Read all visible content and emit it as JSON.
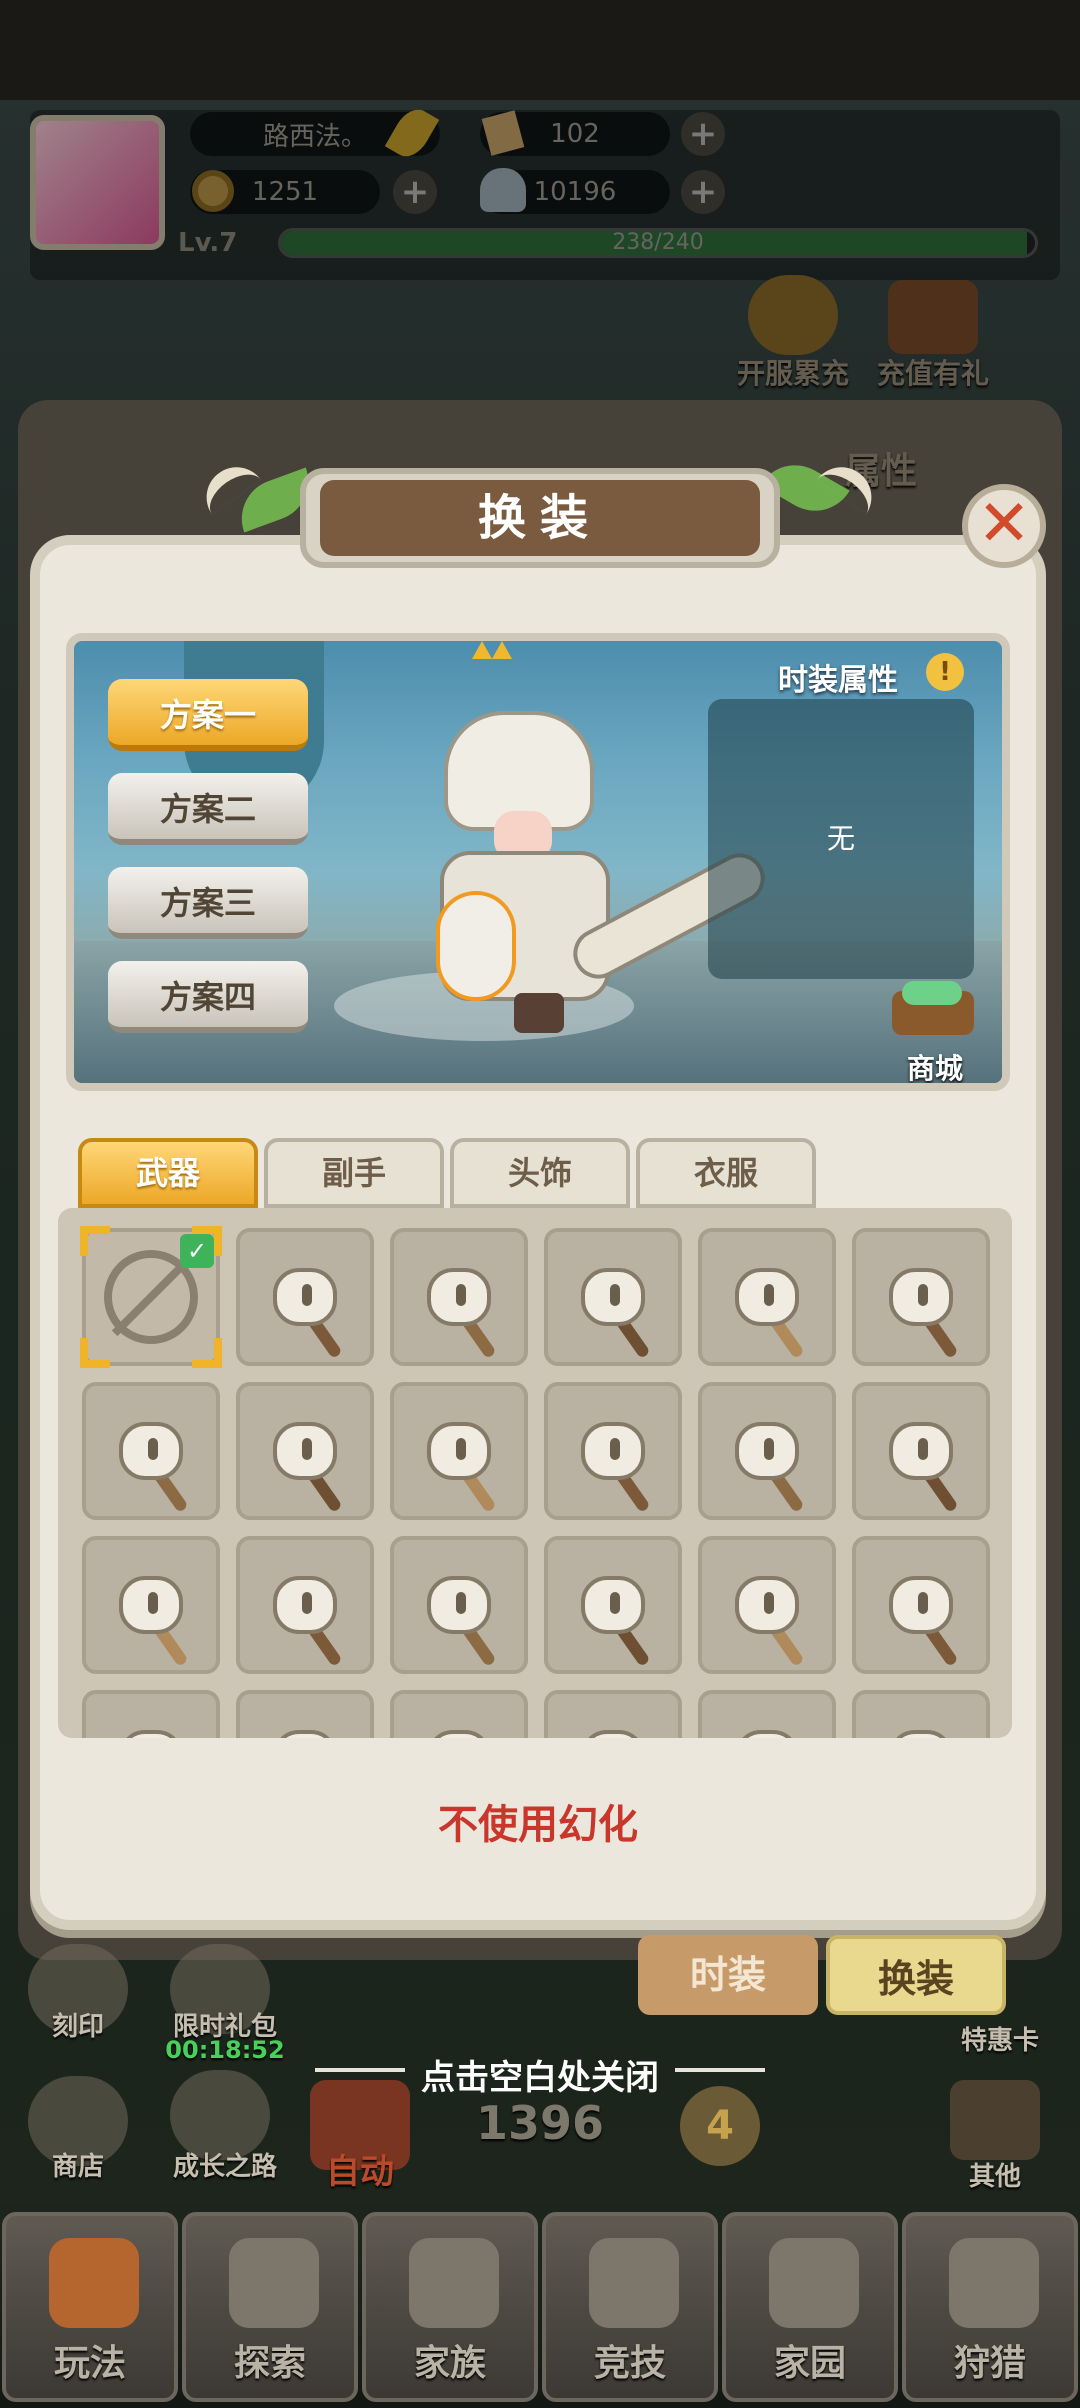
{
  "player": {
    "name": "路西法。",
    "currency1": "102",
    "currency2": "1251",
    "currency3": "10196",
    "level": "Lv.7",
    "xp_text": "238/240",
    "xp_fraction": 0.99
  },
  "events": {
    "event1": "开服累充",
    "event2": "充值有礼",
    "bg_tab": "属性"
  },
  "dialog": {
    "title": "换装",
    "close_glyph": "✕"
  },
  "schemes": [
    "方案一",
    "方案二",
    "方案三",
    "方案四"
  ],
  "fashion_attr": {
    "heading": "时装属性",
    "info_glyph": "!",
    "value": "无"
  },
  "shop_label": "商城",
  "tabs": [
    "武器",
    "副手",
    "头饰",
    "衣服"
  ],
  "no_use_label": "不使用幻化",
  "bottom_tabs": {
    "fashion": "时装",
    "change": "换装"
  },
  "hint": "点击空白处关闭",
  "side_left": {
    "item1": "刻印",
    "item2": "限时礼包",
    "timer": "00:18:52",
    "item3": "商店",
    "item4": "成长之路",
    "auto": "自动"
  },
  "side_right": {
    "item1": "特惠卡",
    "item2": "其他"
  },
  "power": "1396",
  "stage_badge": "4",
  "nav": [
    "玩法",
    "探索",
    "家族",
    "竞技",
    "家园",
    "狩猎"
  ],
  "colors": {
    "accent": "#eca827",
    "panel": "#ece7dc",
    "title_bar": "#7b5b40",
    "warn_text": "#c9362b"
  }
}
